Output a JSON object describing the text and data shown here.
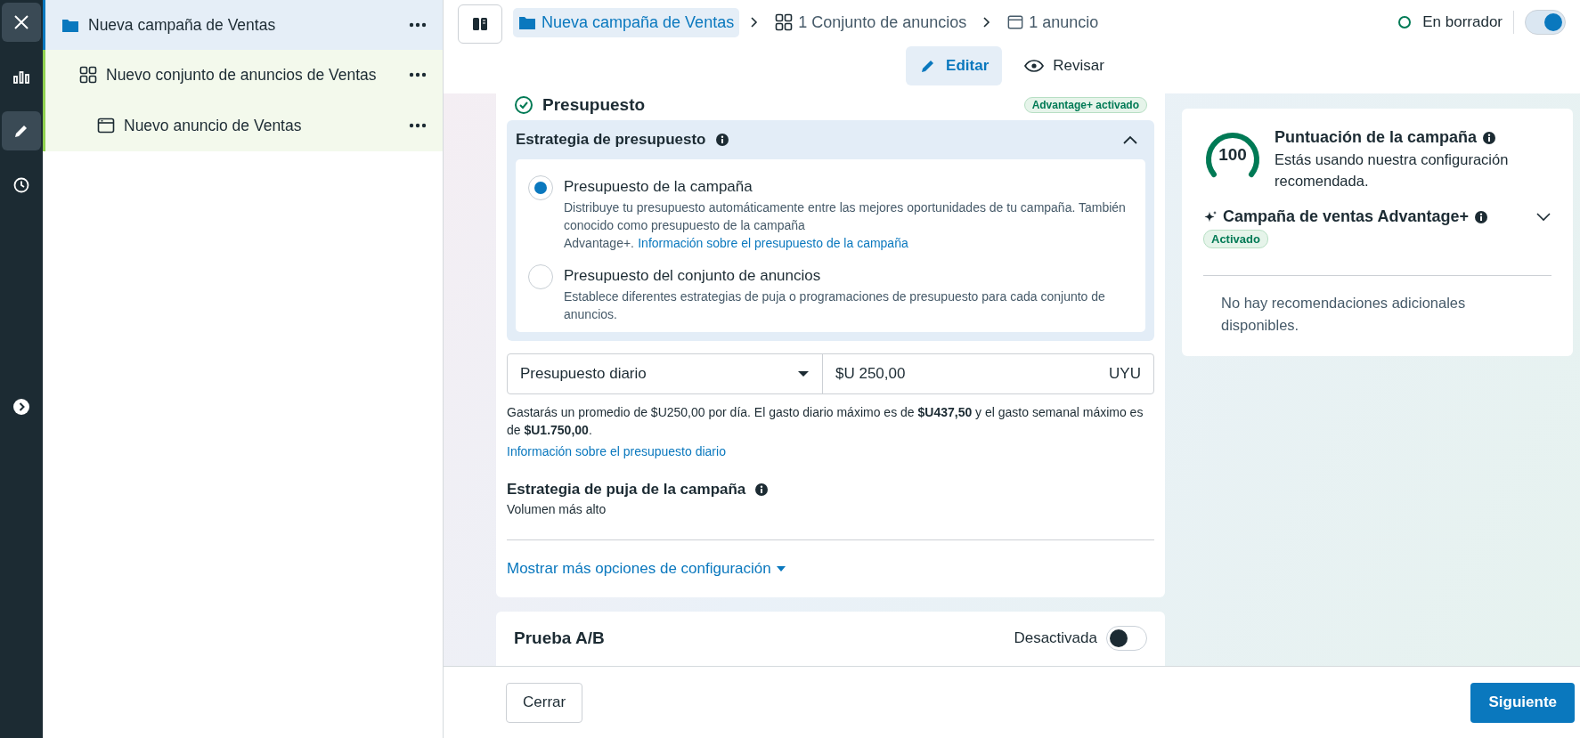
{
  "rail": {
    "items": [
      {
        "kind": "close",
        "selected": true
      },
      {
        "kind": "chart",
        "selected": false
      },
      {
        "kind": "edit",
        "selected": true
      },
      {
        "kind": "history",
        "selected": false
      }
    ],
    "expand": {
      "kind": "expand"
    }
  },
  "tree": [
    {
      "kind": "campaign",
      "label": "Nueva campaña de Ventas",
      "selected": true,
      "children": [
        {
          "kind": "ad_set",
          "label": "Nuevo conjunto de anuncios de Ventas",
          "selected": false,
          "children": [
            {
              "kind": "ad",
              "label": "Nuevo anuncio de Ventas",
              "selected": false
            }
          ]
        }
      ]
    }
  ],
  "header": {
    "breadcrumb": [
      {
        "kind": "campaign",
        "label": "Nueva campaña de Ventas",
        "selected": true
      },
      {
        "kind": "ad_set",
        "label": "1 Conjunto de anuncios",
        "selected": false
      },
      {
        "kind": "ad",
        "label": "1 anuncio",
        "selected": false
      }
    ],
    "status": {
      "label": "En borrador",
      "on": true
    },
    "modes": [
      {
        "kind": "edit",
        "label": "Editar",
        "selected": true
      },
      {
        "kind": "review",
        "label": "Revisar",
        "selected": false
      }
    ]
  },
  "budget_card": {
    "heading": "Presupuesto",
    "badge": "Advantage+ activado",
    "strategy": {
      "title": "Estrategia de presupuesto",
      "expanded": true,
      "options": [
        {
          "title": "Presupuesto de la campaña",
          "description": "Distribuye tu presupuesto automáticamente entre las mejores oportunidades de tu campaña. También conocido como presupuesto de la campaña Advantage+.",
          "link": "Información sobre el presupuesto de la campaña",
          "selected": true
        },
        {
          "title": "Presupuesto del conjunto de anuncios",
          "description": "Establece diferentes estrategias de puja o programaciones de presupuesto para cada conjunto de anuncios.",
          "selected": false
        }
      ]
    },
    "budget": {
      "type": "Presupuesto diario",
      "amount": "$U 250,00",
      "currency": "UYU",
      "note": "Gastarás un promedio de $U250,00 por día. El gasto diario máximo es de **$U437,50** y el gasto semanal máximo es de **$U1.750,00**.",
      "link": "Información sobre el presupuesto diario"
    },
    "bid": {
      "title": "Estrategia de puja de la campaña",
      "value": "Volumen más alto"
    },
    "more_options": "Mostrar más opciones de configuración"
  },
  "ab_test": {
    "title": "Prueba A/B",
    "state_label": "Desactivada",
    "on": false
  },
  "score": {
    "value": "100",
    "level": 1,
    "title": "Puntuación de la campaña",
    "description": "Estás usando nuestra configuración recomendada.",
    "advantage": {
      "title": "Campaña de ventas Advantage+",
      "badge": "Activado",
      "expanded": false
    },
    "empty_message": "No hay recomendaciones adicionales disponibles."
  },
  "footer": {
    "close": "Cerrar",
    "next": "Siguiente"
  }
}
